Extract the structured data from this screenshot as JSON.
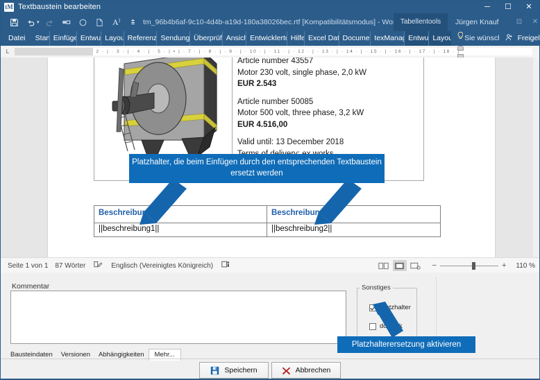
{
  "window": {
    "icon": "tm-app-icon",
    "title": "Textbaustein bearbeiten",
    "minimize": "─",
    "maximize": "☐",
    "close": "✕"
  },
  "quick_access": {
    "items": [
      {
        "name": "save-icon",
        "glyph": "💾"
      },
      {
        "name": "undo-icon",
        "glyph": "↶"
      },
      {
        "name": "redo-icon",
        "glyph": "↻"
      },
      {
        "name": "format-painter-icon",
        "glyph": "❐"
      },
      {
        "name": "circle-icon",
        "glyph": "○"
      },
      {
        "name": "new-document-icon",
        "glyph": "❑"
      },
      {
        "name": "read-aloud-icon",
        "glyph": "Aᵒ"
      },
      {
        "name": "customize-qat-icon",
        "glyph": "≣"
      }
    ]
  },
  "word": {
    "document_title": "tm_96b4b6af-9c10-4d4b-a19d-180a38026bec.rtf [Kompatibilitätsmodus]  -  Word",
    "contextual_group": "Tabellentools",
    "user": "Jürgen Knauf",
    "ribbon_tabs": [
      "Datei",
      "Start",
      "Einfügen",
      "Entwurf",
      "Layout",
      "Referenzen",
      "Sendungen",
      "Überprüfen",
      "Ansicht",
      "Entwicklertools",
      "Hilfe",
      "Excel Daten",
      "Document-",
      "texManager"
    ],
    "contextual_tabs": [
      "Entwurf",
      "Layout"
    ],
    "tell_me": "Sie wünschen",
    "share": "Freigeben",
    "bulb_icon": "lightbulb-icon",
    "share_icon": "share-person-icon"
  },
  "ruler": {
    "marks": "· 2 · | · 1 · | ▪  · | · 1 · | · 2 · | · 3 · | · 4 · | · 5 · | ▪ | · 7 · | · 8 · | · 9 · | · 10 · | · 11 · | · 12 · | · 13 · | · 14 · | · 15 · | · 16 · | · 17 · | · 18 · |",
    "corner_label": "L"
  },
  "document": {
    "price_block": {
      "line1": "Article number 43557",
      "line2": "Motor 230 volt, single phase, 2,0 kW",
      "price1": "EUR 2.543",
      "line3": "Article number 50085",
      "line4": "Motor 500 volt, three phase, 3,2  kW",
      "price2": "EUR 4.516,00",
      "valid": "Valid until: 13 December 2018",
      "terms": "Terms of delivery: ex works"
    },
    "desc_table": {
      "head": [
        "Beschreibung 1:",
        "Beschreibung 2:"
      ],
      "body": [
        "||beschreibung1||",
        "||beschreibung2||"
      ]
    }
  },
  "callouts": {
    "placeholder": "Platzhalter, die beim Einfügen durch den entsprechenden Textbaustein ersetzt werden",
    "activate": "Platzhalterersetzung aktivieren"
  },
  "statusbar": {
    "page": "Seite 1 von 1",
    "words": "87 Wörter",
    "proofing_icon": "proofing-icon",
    "language": "Englisch (Vereinigtes Königreich)",
    "accessibility_icon": "accessibility-icon",
    "view_read_icon": "read-mode-icon",
    "view_print_icon": "print-layout-icon",
    "view_web_icon": "web-layout-icon",
    "zoom_minus": "−",
    "zoom_plus": "+",
    "zoom_value": "110 %"
  },
  "panel": {
    "comment_label": "Kommentar",
    "comment_value": "",
    "comment_placeholder": "",
    "group_sonstiges": "Sonstiges",
    "checkboxes": [
      {
        "label": "Platzhalter",
        "checked": true
      },
      {
        "label": "docLink",
        "checked": false
      }
    ],
    "tabs": [
      {
        "label": "Bausteindaten",
        "active": false
      },
      {
        "label": "Versionen",
        "active": false
      },
      {
        "label": "Abhängigkeiten",
        "active": false
      },
      {
        "label": "Mehr...",
        "active": true
      }
    ],
    "save_label": "Speichern",
    "cancel_label": "Abbrechen",
    "save_icon": "floppy-disk-icon",
    "cancel_icon": "red-x-icon"
  },
  "colors": {
    "titlebar": "#2b5c8a",
    "ribbon": "#2b5c8a",
    "callout": "#0f6cb8",
    "heading_blue": "#1f5fa8",
    "cancel_red": "#b42020"
  }
}
